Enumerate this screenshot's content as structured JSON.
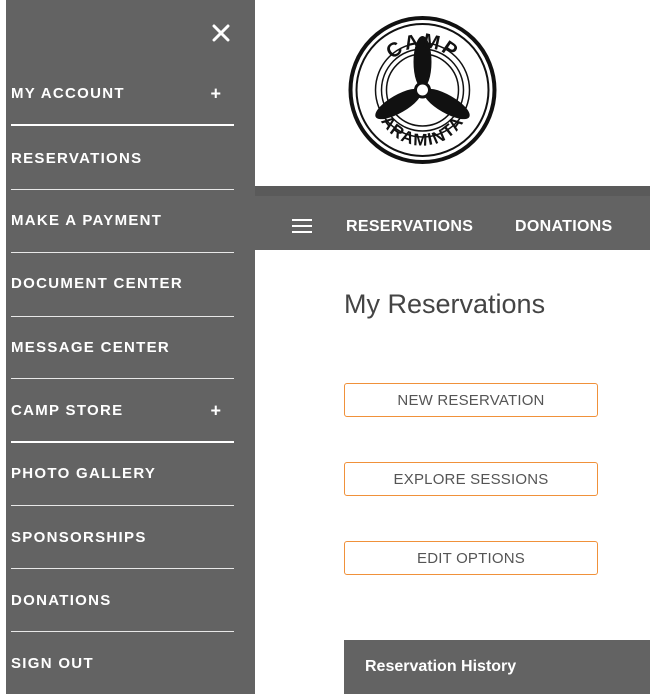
{
  "drawer": {
    "items": [
      {
        "label": "MY ACCOUNT",
        "has_plus": true
      },
      {
        "label": "RESERVATIONS"
      },
      {
        "label": "MAKE A PAYMENT"
      },
      {
        "label": "DOCUMENT CENTER"
      },
      {
        "label": "MESSAGE CENTER"
      },
      {
        "label": "CAMP STORE",
        "has_plus": true
      },
      {
        "label": "PHOTO GALLERY"
      },
      {
        "label": "SPONSORSHIPS"
      },
      {
        "label": "DONATIONS"
      },
      {
        "label": "SIGN OUT"
      }
    ],
    "plus_symbol": "+",
    "close_icon": "close-icon"
  },
  "logo": {
    "top_text": "CAMP",
    "bottom_text": "ARAMINTA"
  },
  "topbar": {
    "links": [
      "RESERVATIONS",
      "DONATIONS"
    ]
  },
  "main": {
    "title": "My Reservations",
    "buttons": [
      "NEW RESERVATION",
      "EXPLORE SESSIONS",
      "EDIT OPTIONS"
    ],
    "history_title": "Reservation History"
  },
  "colors": {
    "drawer_bg": "#636363",
    "accent_orange": "#f0913a",
    "text_dark": "#444444"
  }
}
